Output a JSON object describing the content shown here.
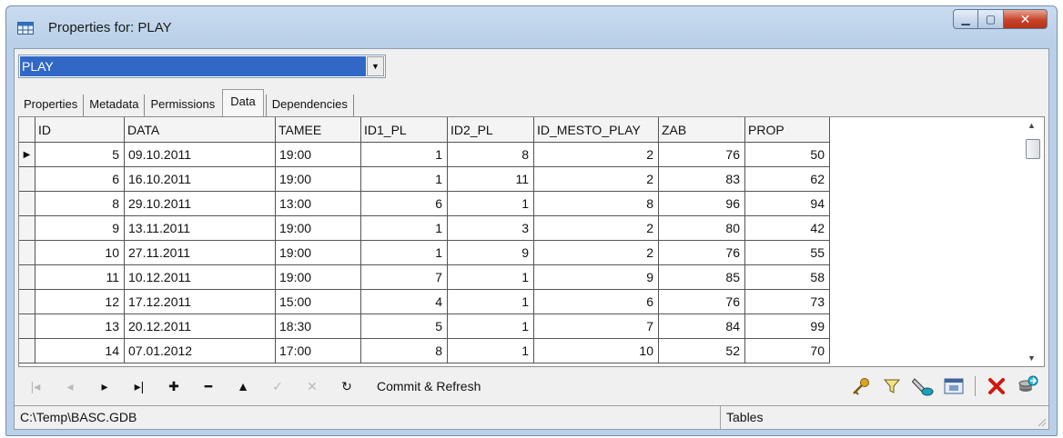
{
  "window": {
    "title": "Properties for: PLAY",
    "icon": "table-icon",
    "buttons": {
      "minimize": "minimize-icon",
      "maximize": "maximize-icon",
      "close": "close-icon"
    }
  },
  "table_selector": {
    "value": "PLAY",
    "icon": "dropdown-arrow-icon"
  },
  "tabs": [
    {
      "label": "Properties",
      "active": false
    },
    {
      "label": "Metadata",
      "active": false
    },
    {
      "label": "Permissions",
      "active": false
    },
    {
      "label": "Data",
      "active": true
    },
    {
      "label": "Dependencies",
      "active": false
    }
  ],
  "grid": {
    "columns": [
      "ID",
      "DATA",
      "TAMEE",
      "ID1_PL",
      "ID2_PL",
      "ID_MESTO_PLAY",
      "ZAB",
      "PROP"
    ],
    "current_row": 0,
    "rows": [
      [
        "5",
        "09.10.2011",
        "19:00",
        "1",
        "8",
        "2",
        "76",
        "50"
      ],
      [
        "6",
        "16.10.2011",
        "19:00",
        "1",
        "11",
        "2",
        "83",
        "62"
      ],
      [
        "8",
        "29.10.2011",
        "13:00",
        "6",
        "1",
        "8",
        "96",
        "94"
      ],
      [
        "9",
        "13.11.2011",
        "19:00",
        "1",
        "3",
        "2",
        "80",
        "42"
      ],
      [
        "10",
        "27.11.2011",
        "19:00",
        "1",
        "9",
        "2",
        "76",
        "55"
      ],
      [
        "11",
        "10.12.2011",
        "19:00",
        "7",
        "1",
        "9",
        "85",
        "58"
      ],
      [
        "12",
        "17.12.2011",
        "15:00",
        "4",
        "1",
        "6",
        "76",
        "73"
      ],
      [
        "13",
        "20.12.2011",
        "18:30",
        "5",
        "1",
        "7",
        "84",
        "99"
      ],
      [
        "14",
        "07.01.2012",
        "17:00",
        "8",
        "1",
        "10",
        "52",
        "70"
      ]
    ]
  },
  "navigator": {
    "buttons": [
      {
        "name": "first-record-icon",
        "glyph": "|◂",
        "enabled": false
      },
      {
        "name": "prior-record-icon",
        "glyph": "◂",
        "enabled": false
      },
      {
        "name": "next-record-icon",
        "glyph": "▸",
        "enabled": true
      },
      {
        "name": "last-record-icon",
        "glyph": "▸|",
        "enabled": true
      },
      {
        "name": "insert-record-icon",
        "glyph": "✚",
        "enabled": true
      },
      {
        "name": "delete-record-icon",
        "glyph": "━",
        "enabled": true
      },
      {
        "name": "edit-record-icon",
        "glyph": "▲",
        "enabled": true
      },
      {
        "name": "post-edit-icon",
        "glyph": "✓",
        "enabled": false
      },
      {
        "name": "cancel-edit-icon",
        "glyph": "✕",
        "enabled": false
      },
      {
        "name": "refresh-icon",
        "glyph": "↻",
        "enabled": true
      }
    ],
    "commit_label": "Commit & Refresh"
  },
  "toolbar_icons": [
    "key-icon",
    "filter-icon",
    "pen-icon",
    "grid-view-icon",
    "delete-icon",
    "export-icon"
  ],
  "status": {
    "path": "C:\\Temp\\BASC.GDB",
    "context": "Tables"
  }
}
